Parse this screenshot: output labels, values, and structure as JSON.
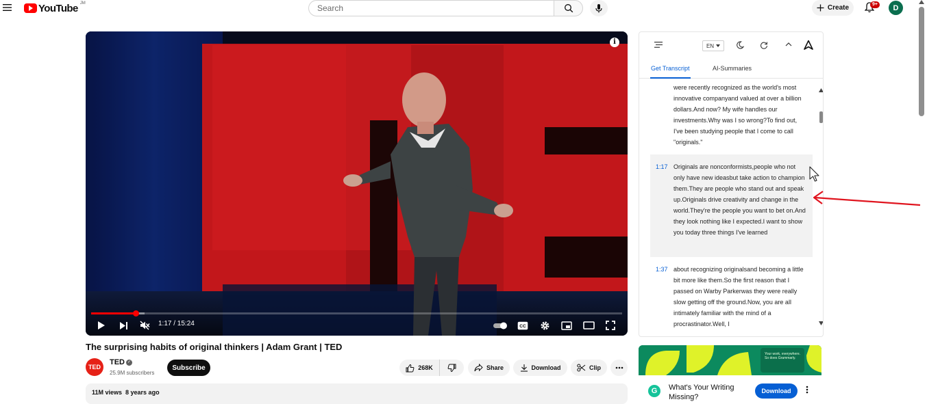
{
  "header": {
    "logo_text": "YouTube",
    "logo_badge": "JM",
    "search_placeholder": "Search",
    "create_label": "Create",
    "notification_count": "9+",
    "avatar_letter": "D"
  },
  "player": {
    "time": "1:17 / 15:24",
    "progress_fraction": 0.0833,
    "buffer_fraction": 0.1,
    "info_glyph": "i"
  },
  "video": {
    "title": "The surprising habits of original thinkers | Adam Grant | TED",
    "channel_name": "TED",
    "channel_avatar_text": "TED",
    "subscribers": "25.9M subscribers",
    "subscribe_label": "Subscribe",
    "likes": "268K",
    "share_label": "Share",
    "download_label": "Download",
    "clip_label": "Clip",
    "views_date": "11M views  8 years ago"
  },
  "transcript_panel": {
    "language": "EN",
    "tabs": [
      "Get Transcript",
      "AI-Summaries"
    ],
    "segments": [
      {
        "time": "",
        "text": "were recently recognized as the world's most innovative companyand valued at over a billion dollars.And now? My wife handles our investments.Why was I so wrong?To find out, I've been studying people that I come to call \"originals.\""
      },
      {
        "time": "1:17",
        "text": "Originals are nonconformists,people who not only have new ideasbut take action to champion them.They are people who stand out and speak up.Originals drive creativity and change in the world.They're the people you want to bet on.And they look nothing like I expected.I want to show you today three things I've learned"
      },
      {
        "time": "1:37",
        "text": "about recognizing originalsand becoming a little bit more like them.So the first reason that I passed on Warby Parkerwas they were really slow getting off the ground.Now, you are all intimately familiar with the mind of a procrastinator.Well, I"
      }
    ]
  },
  "ad": {
    "banner_text": "Your work, everywhere. So does Grammarly.",
    "logo_letter": "G",
    "headline": "What's Your Writing Missing?",
    "cta": "Download"
  },
  "colors": {
    "accent": "#065fd4",
    "brand_red": "#ff0000",
    "annotation_red": "#e0141e"
  }
}
